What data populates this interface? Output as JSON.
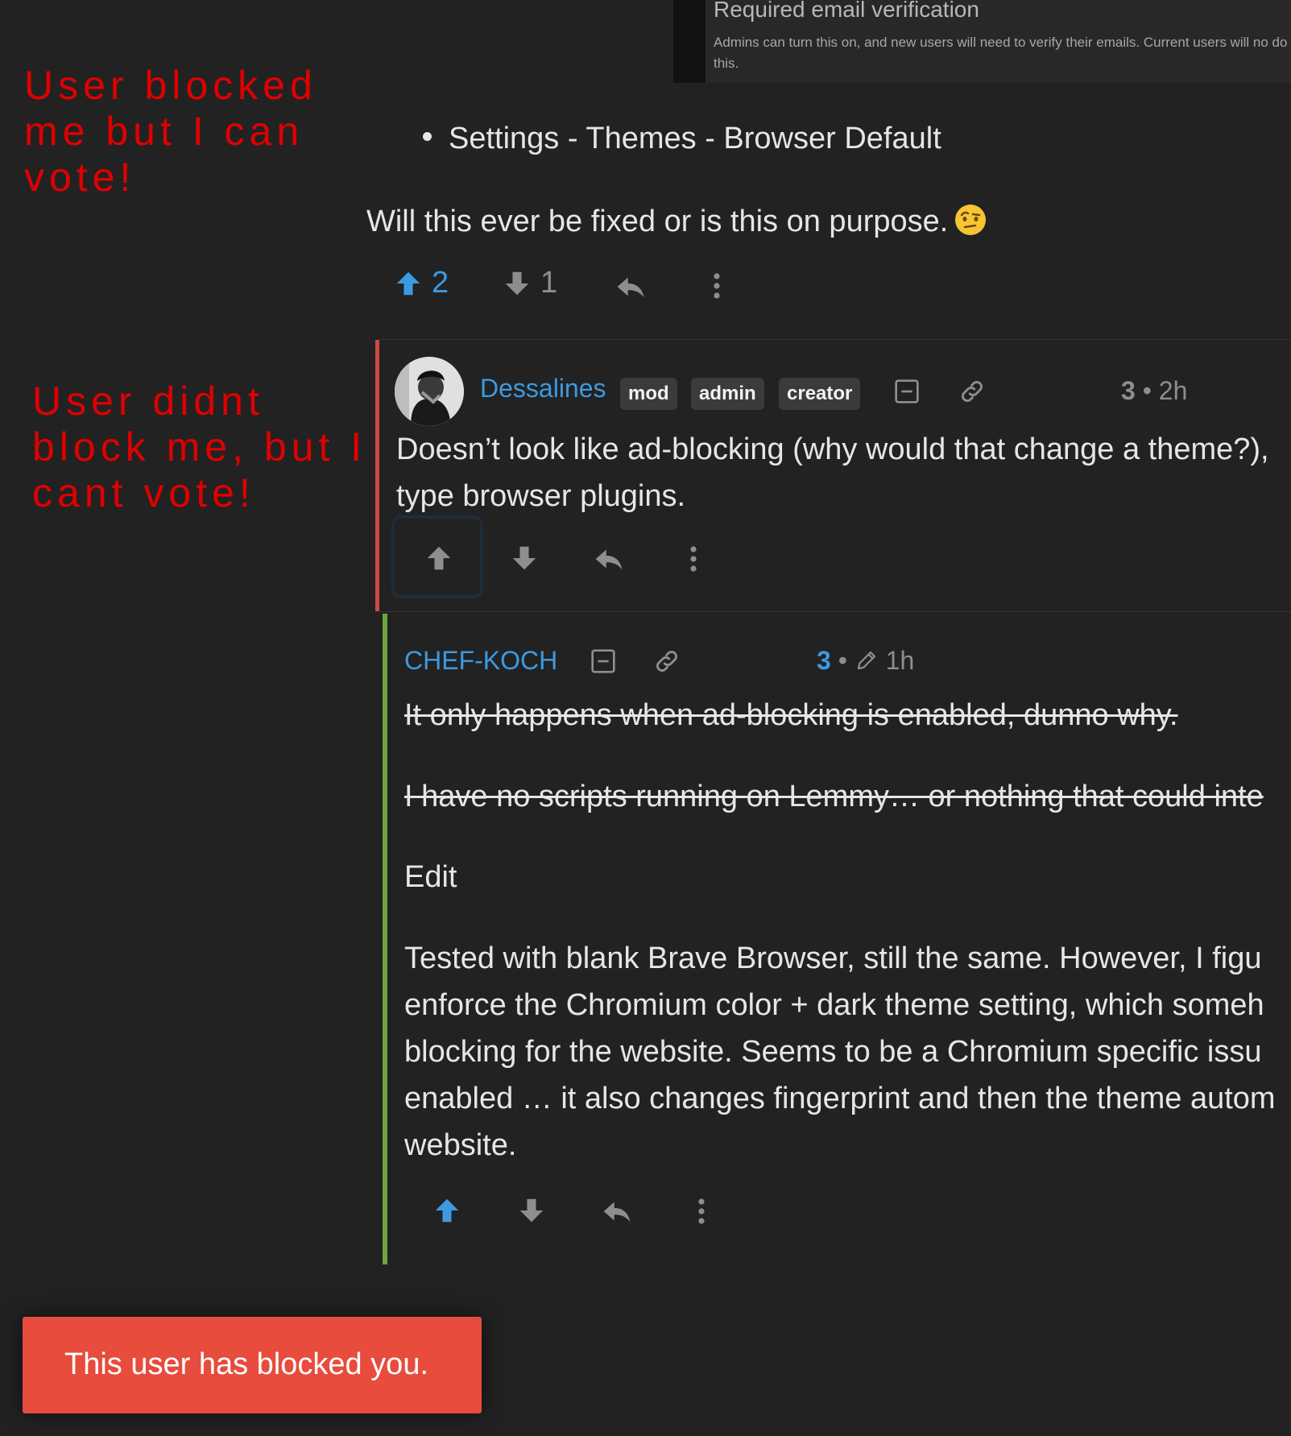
{
  "embed": {
    "title": "Required email verification",
    "description": "Admins can turn this on, and new users will need to verify their emails. Current users will no do this."
  },
  "annotations": {
    "top": "User blocked\nme but I can\nvote!",
    "middle": "User didnt\nblock me, but I\ncant vote!"
  },
  "post": {
    "bullet": "Settings - Themes - Browser Default",
    "text": "Will this ever be fixed or is this on purpose.",
    "emoji": "raised-eyebrow-emoji",
    "upvotes": "2",
    "downvotes": "1"
  },
  "comment1": {
    "username": "Dessalines",
    "badges": [
      "mod",
      "admin",
      "creator"
    ],
    "score": "3",
    "separator": "•",
    "age": "2h",
    "text_line1": "Doesn’t look like ad-blocking (why would that change a theme?),",
    "text_line2": "type browser plugins."
  },
  "comment2": {
    "username": "CHEF-KOCH",
    "score": "3",
    "separator": "•",
    "age": "1h",
    "struck1": "It only happens when ad-blocking is enabled, dunno why.",
    "struck2": "I have no scripts running on Lemmy… or nothing that could inte",
    "edit": "Edit",
    "body_lines": [
      "Tested with blank Brave Browser, still the same. However, I figu",
      "enforce the Chromium color + dark theme setting, which someh",
      "blocking for the website. Seems to be a Chromium specific issu",
      "enabled … it also changes fingerprint and then the theme autom",
      "website."
    ]
  },
  "toast": {
    "message": "This user has blocked you."
  },
  "colors": {
    "background": "#222222",
    "accent_blue": "#3c9ae2",
    "annotation_red": "#e00000",
    "toast_red": "#e74c3c",
    "comment_border_red": "#c94a46",
    "comment_border_green": "#6ca53b"
  }
}
